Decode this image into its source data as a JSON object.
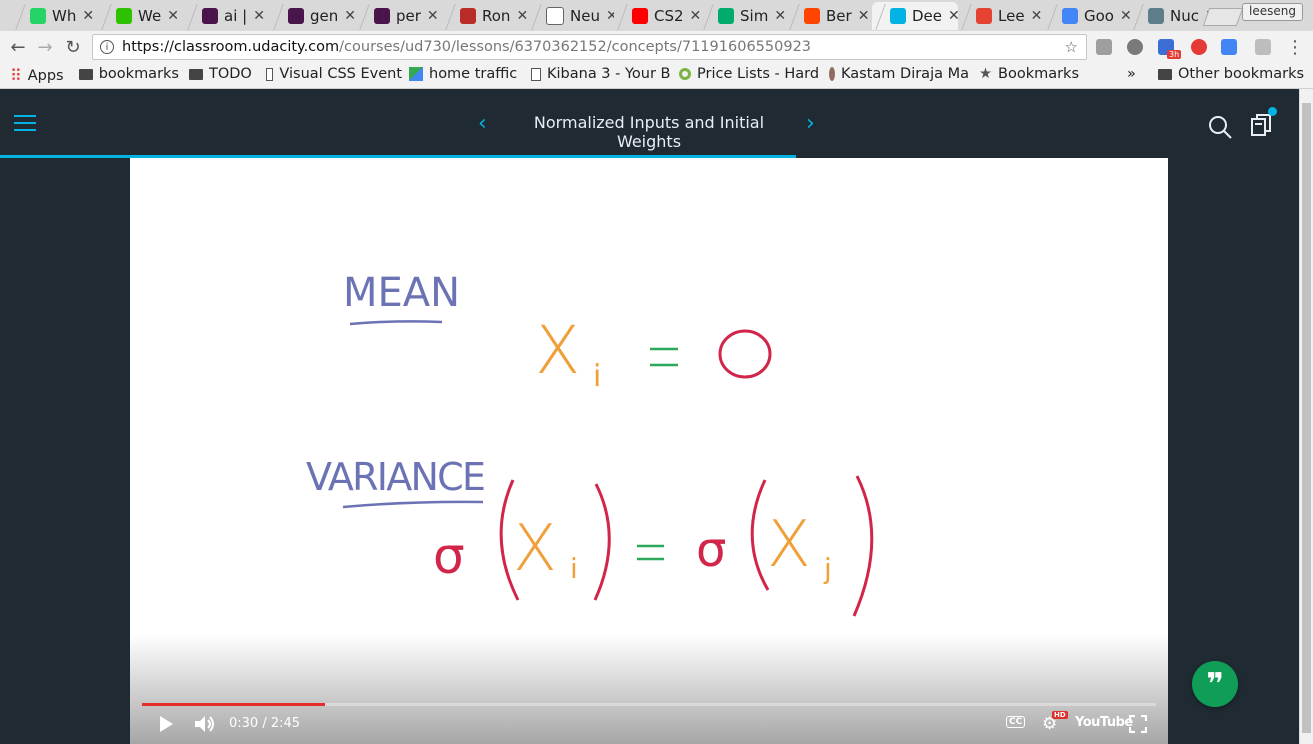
{
  "browser": {
    "tabs": [
      {
        "label": "Wh",
        "favicon_color": "#25d366",
        "icon": "whatsapp-icon"
      },
      {
        "label": "We",
        "favicon_color": "#2dc100",
        "icon": "wechat-icon"
      },
      {
        "label": "ai |",
        "favicon_color": "#4a154b",
        "icon": "slack-icon"
      },
      {
        "label": "gen",
        "favicon_color": "#4a154b",
        "icon": "slack-icon"
      },
      {
        "label": "per",
        "favicon_color": "#4a154b",
        "icon": "slack-icon"
      },
      {
        "label": "Ron",
        "favicon_color": "#b92b27",
        "icon": "quora-icon"
      },
      {
        "label": "Neu",
        "favicon_color": "#ffffff",
        "icon": "page-icon"
      },
      {
        "label": "CS2",
        "favicon_color": "#ff0000",
        "icon": "youtube-icon"
      },
      {
        "label": "Sim",
        "favicon_color": "#00ab6c",
        "icon": "medium-icon"
      },
      {
        "label": "Ber",
        "favicon_color": "#ff4500",
        "icon": "reddit-icon"
      },
      {
        "label": "Dee",
        "favicon_color": "#02b3e4",
        "icon": "udacity-icon",
        "active": true
      },
      {
        "label": "Lee",
        "favicon_color": "#e44332",
        "icon": "todoist-icon"
      },
      {
        "label": "Goo",
        "favicon_color": "#4285f4",
        "icon": "calendar-icon"
      },
      {
        "label": "Nuc",
        "favicon_color": "#607d8b",
        "icon": "avatar-icon"
      }
    ],
    "profile_name": "leeseng",
    "url_host": "https://classroom.udacity.com",
    "url_path": "/courses/ud730/lessons/6370362152/concepts/71191606550923",
    "bookmarks": [
      {
        "label": "Apps",
        "icon": "apps-grid-icon"
      },
      {
        "label": "bookmarks",
        "icon": "folder-icon"
      },
      {
        "label": "TODO",
        "icon": "folder-icon"
      },
      {
        "label": "Visual CSS Event",
        "icon": "page-icon"
      },
      {
        "label": "home traffic",
        "icon": "maps-icon"
      },
      {
        "label": "Kibana 3 - Your B",
        "icon": "page-icon"
      },
      {
        "label": "Price Lists - Hard",
        "icon": "circle-icon"
      },
      {
        "label": "Kastam Diraja Ma",
        "icon": "crest-icon"
      },
      {
        "label": "Bookmarks",
        "icon": "star-icon"
      }
    ],
    "overflow_label": "»",
    "other_bookmarks": "Other bookmarks",
    "extension_badge": "3h"
  },
  "app": {
    "lesson_title": "Normalized Inputs and Initial Weights",
    "prev_arrow": "‹",
    "next_arrow": "›"
  },
  "video": {
    "time_current": "0:30",
    "time_total": "2:45",
    "time_display": "0:30 / 2:45",
    "progress_fraction": 0.18,
    "cc_label": "CC",
    "hd_label": "HD",
    "youtube_label": "YouTube",
    "whiteboard": {
      "mean_label": "MEAN",
      "variance_label": "VARIANCE",
      "mean_eq_lhs": "X",
      "mean_eq_sub": "i",
      "equals": "=",
      "zero": "0",
      "sigma": "σ",
      "var_sub_i": "i",
      "var_sub_j": "j"
    }
  },
  "colors": {
    "accent": "#02b3e4",
    "header_bg": "#1f2a33",
    "ink_blue": "#6b73b5",
    "ink_orange": "#f0a03a",
    "ink_green": "#2ca85a",
    "ink_red": "#d2254a"
  }
}
